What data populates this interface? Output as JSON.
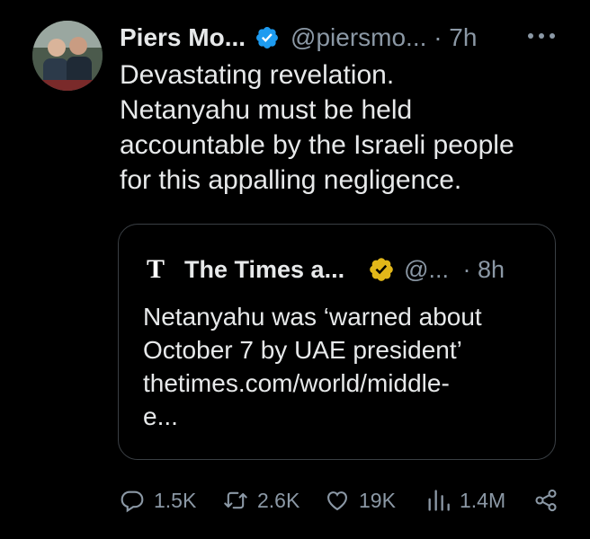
{
  "tweet": {
    "author_name": "Piers Mo...",
    "handle": "@piersmo...",
    "time": "· 7h",
    "text": "Devastating revelation.\nNetanyahu must be held\naccountable by the Israeli people\nfor this appalling negligence."
  },
  "quote": {
    "logo_letter": "T",
    "author_name": "The Times a...",
    "handle": "@...",
    "time": "· 8h",
    "text": "Netanyahu was ‘warned about\nOctober 7 by UAE president’\nthetimes.com/world/middle-\ne..."
  },
  "actions": {
    "replies": "1.5K",
    "reposts": "2.6K",
    "likes": "19K",
    "views": "1.4M"
  },
  "icons": [
    "verified-badge-icon",
    "gold-verified-badge-icon",
    "more-icon",
    "reply-icon",
    "repost-icon",
    "like-icon",
    "views-icon",
    "share-icon"
  ],
  "colors": {
    "background": "#000000",
    "text": "#e7e9ea",
    "muted": "#8b98a5",
    "verified_blue": "#1d9bf0",
    "gold": "#e2b719"
  }
}
